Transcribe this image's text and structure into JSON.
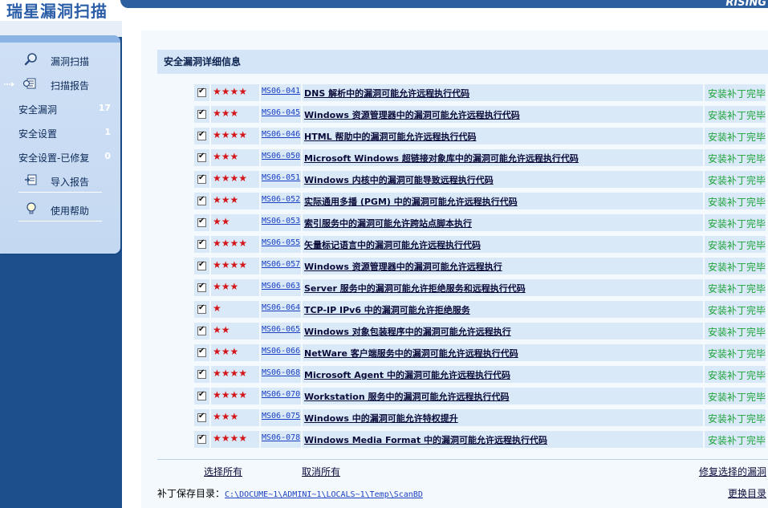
{
  "app": {
    "title": "瑞星漏洞扫描",
    "logo_text": "RISING"
  },
  "sidebar": {
    "items": [
      {
        "label": "漏洞扫描",
        "icon": "magnifier-icon"
      },
      {
        "label": "扫描报告",
        "icon": "report-icon"
      },
      {
        "label": "安全漏洞",
        "count": "17"
      },
      {
        "label": "安全设置",
        "count": "1"
      },
      {
        "label": "安全设置-已修复",
        "count": "0"
      },
      {
        "label": "导入报告",
        "icon": "import-icon"
      },
      {
        "label": "使用帮助",
        "icon": "lightbulb-icon"
      }
    ]
  },
  "main": {
    "section_title": "安全漏洞详细信息",
    "vulnerabilities": [
      {
        "checked": true,
        "stars": "★★★★",
        "id": "MS06-041",
        "title": "DNS 解析中的漏洞可能允许远程执行代码",
        "status": "安装补丁完毕"
      },
      {
        "checked": true,
        "stars": "★★★",
        "id": "MS06-045",
        "title": "Windows 资源管理器中的漏洞可能允许远程执行代码",
        "status": "安装补丁完毕"
      },
      {
        "checked": true,
        "stars": "★★★★",
        "id": "MS06-046",
        "title": "HTML 帮助中的漏洞可能允许远程执行代码",
        "status": "安装补丁完毕"
      },
      {
        "checked": true,
        "stars": "★★★",
        "id": "MS06-050",
        "title": "Microsoft Windows 超链接对象库中的漏洞可能允许远程执行代码",
        "status": "安装补丁完毕"
      },
      {
        "checked": true,
        "stars": "★★★★",
        "id": "MS06-051",
        "title": "Windows 内核中的漏洞可能导致远程执行代码",
        "status": "安装补丁完毕"
      },
      {
        "checked": true,
        "stars": "★★★",
        "id": "MS06-052",
        "title": "实际通用多播 (PGM) 中的漏洞可能允许远程执行代码",
        "status": "安装补丁完毕"
      },
      {
        "checked": true,
        "stars": "★★",
        "id": "MS06-053",
        "title": "索引服务中的漏洞可能允许跨站点脚本执行",
        "status": "安装补丁完毕"
      },
      {
        "checked": true,
        "stars": "★★★★",
        "id": "MS06-055",
        "title": "矢量标记语言中的漏洞可能允许远程执行代码",
        "status": "安装补丁完毕"
      },
      {
        "checked": true,
        "stars": "★★★★",
        "id": "MS06-057",
        "title": "Windows 资源管理器中的漏洞可能允许远程执行",
        "status": "安装补丁完毕"
      },
      {
        "checked": true,
        "stars": "★★★",
        "id": "MS06-063",
        "title": "Server 服务中的漏洞可能允许拒绝服务和远程执行代码",
        "status": "安装补丁完毕"
      },
      {
        "checked": true,
        "stars": "★",
        "id": "MS06-064",
        "title": "TCP-IP IPv6 中的漏洞可能允许拒绝服务",
        "status": "安装补丁完毕"
      },
      {
        "checked": true,
        "stars": "★★",
        "id": "MS06-065",
        "title": "Windows 对象包装程序中的漏洞可能允许远程执行",
        "status": "安装补丁完毕"
      },
      {
        "checked": true,
        "stars": "★★★",
        "id": "MS06-066",
        "title": "NetWare 客户端服务中的漏洞可能允许远程执行代码",
        "status": "安装补丁完毕"
      },
      {
        "checked": true,
        "stars": "★★★★",
        "id": "MS06-068",
        "title": "Microsoft Agent 中的漏洞可能允许远程执行代码",
        "status": "安装补丁完毕"
      },
      {
        "checked": true,
        "stars": "★★★★",
        "id": "MS06-070",
        "title": "Workstation 服务中的漏洞可能允许远程执行代码",
        "status": "安装补丁完毕"
      },
      {
        "checked": true,
        "stars": "★★★",
        "id": "MS06-075",
        "title": "Windows 中的漏洞可能允许特权提升",
        "status": "安装补丁完毕"
      },
      {
        "checked": true,
        "stars": "★★★★",
        "id": "MS06-078",
        "title": "Windows Media Format 中的漏洞可能允许远程执行代码",
        "status": "安装补丁完毕"
      }
    ],
    "actions": {
      "select_all": "选择所有",
      "deselect_all": "取消所有",
      "fix_selected": "修复选择的漏洞"
    },
    "patch_dir_label": "补丁保存目录：",
    "patch_dir_value": "C:\\DOCUME~1\\ADMINI~1\\LOCALS~1\\Temp\\ScanBD",
    "change_dir": "更换目录"
  },
  "colors": {
    "accent": "#2d5e9e",
    "sidebar_dark": "#1e4f8d",
    "row_bg": "#d9e9f8",
    "status_green": "#1fa33a",
    "star_red": "#d4161b"
  }
}
